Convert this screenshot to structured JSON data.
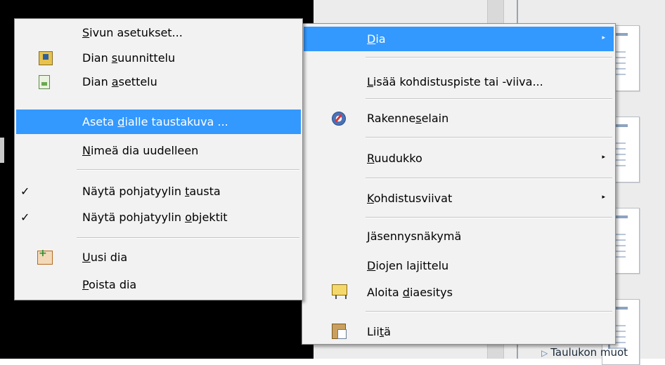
{
  "background": {
    "bottom_label": "Taulukon muot"
  },
  "submenu": {
    "items": [
      {
        "pre": "",
        "u": "S",
        "post": "ivun asetukset..."
      },
      {
        "pre": "Dian ",
        "u": "s",
        "post": "uunnittelu",
        "icon": "slide-design-icon"
      },
      {
        "pre": "Dian ",
        "u": "a",
        "post": "settelu",
        "icon": "slide-layout-icon"
      },
      {
        "pre": "Aseta ",
        "u": "d",
        "post": "ialle taustakuva ..."
      },
      {
        "pre": "",
        "u": "N",
        "post": "imeä dia uudelleen"
      },
      {
        "pre": "Näytä pohjatyylin ",
        "u": "t",
        "post": "austa",
        "check": "✓"
      },
      {
        "pre": "Näytä pohjatyylin ",
        "u": "o",
        "post": "bjektit",
        "check": "✓"
      },
      {
        "pre": "",
        "u": "U",
        "post": "usi dia",
        "icon": "new-slide-icon"
      },
      {
        "pre": "",
        "u": "P",
        "post": "oista dia"
      }
    ]
  },
  "mainmenu": {
    "items": [
      {
        "pre": "",
        "u": "D",
        "post": "ia",
        "arrow": "▸"
      },
      {
        "pre": "",
        "u": "L",
        "post": "isää kohdistuspiste tai -viiva..."
      },
      {
        "pre": "Rakenne",
        "u": "s",
        "post": "elain",
        "icon": "navigator-icon"
      },
      {
        "pre": "",
        "u": "R",
        "post": "uudukko",
        "arrow": "▸"
      },
      {
        "pre": "",
        "u": "K",
        "post": "ohdistusviivat",
        "arrow": "▸"
      },
      {
        "pre": "",
        "u": "J",
        "post": "äsennysnäkymä"
      },
      {
        "pre": "",
        "u": "D",
        "post": "iojen lajittelu"
      },
      {
        "pre": "Aloita ",
        "u": "d",
        "post": "iaesitys",
        "icon": "presentation-icon"
      },
      {
        "pre": "Lii",
        "u": "t",
        "post": "ä",
        "icon": "paste-icon"
      }
    ]
  }
}
